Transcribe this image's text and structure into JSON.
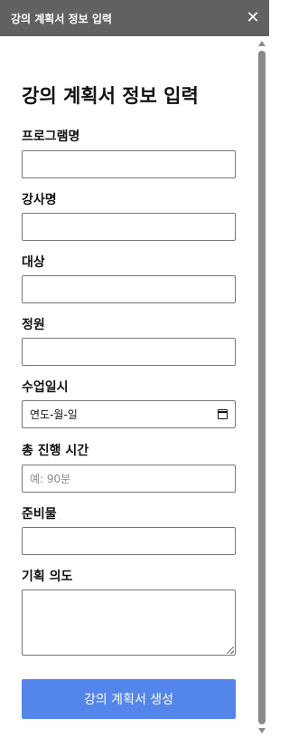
{
  "window": {
    "title": "강의 계획서 정보 입력",
    "close_symbol": "✕"
  },
  "form": {
    "heading": "강의 계획서 정보 입력",
    "fields": {
      "program": {
        "label": "프로그램명",
        "value": ""
      },
      "instructor": {
        "label": "강사명",
        "value": ""
      },
      "audience": {
        "label": "대상",
        "value": ""
      },
      "capacity": {
        "label": "정원",
        "value": ""
      },
      "class_date": {
        "label": "수업일시",
        "display": "연도-월-일"
      },
      "duration": {
        "label": "총 진행 시간",
        "placeholder": "예: 90분"
      },
      "materials": {
        "label": "준비물",
        "value": ""
      },
      "intent": {
        "label": "기획 의도",
        "value": ""
      }
    },
    "submit_label": "강의 계획서 생성"
  },
  "colors": {
    "titlebar_bg": "#616161",
    "submit_bg": "#5485ea",
    "scrollbar": "#8a8a8a"
  },
  "icons": [
    "close-icon",
    "calendar-icon",
    "scroll-up-arrow-icon",
    "scroll-down-arrow-icon",
    "resize-grip-icon"
  ]
}
